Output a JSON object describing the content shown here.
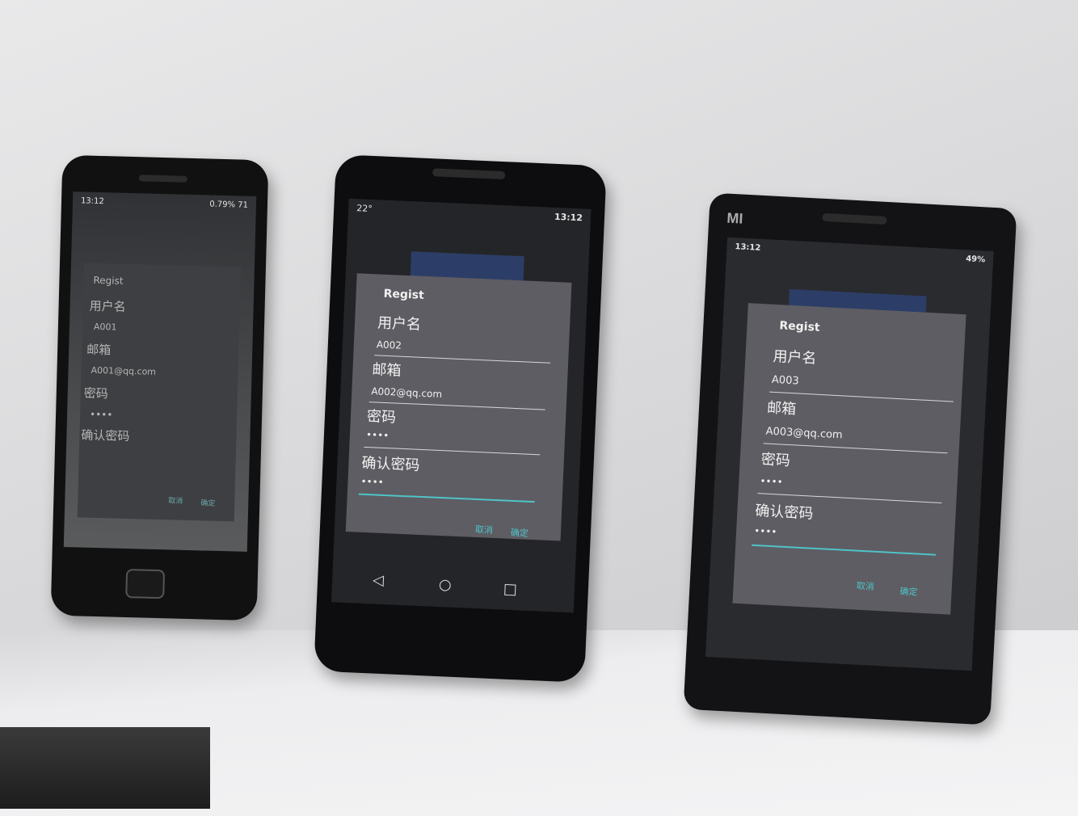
{
  "phones": [
    {
      "status_time": "13:12",
      "status_right": "0.79%   71",
      "dialog": {
        "title": "Regist",
        "username_label": "用户名",
        "username_value": "A001",
        "email_label": "邮箱",
        "email_value": "A001@qq.com",
        "password_label": "密码",
        "password_value": "••••",
        "confirm_label": "确认密码",
        "confirm_value": "",
        "cancel": "取消",
        "ok": "确定"
      }
    },
    {
      "status_time": "13:12",
      "status_left": "22°",
      "dialog": {
        "title": "Regist",
        "username_label": "用户名",
        "username_value": "A002",
        "email_label": "邮箱",
        "email_value": "A002@qq.com",
        "password_label": "密码",
        "password_value": "••••",
        "confirm_label": "确认密码",
        "confirm_value": "••••",
        "cancel": "取消",
        "ok": "确定"
      }
    },
    {
      "brand": "MI",
      "status_time": "13:12",
      "status_battery": "49%",
      "dialog": {
        "title": "Regist",
        "username_label": "用户名",
        "username_value": "A003",
        "email_label": "邮箱",
        "email_value": "A003@qq.com",
        "password_label": "密码",
        "password_value": "••••",
        "confirm_label": "确认密码",
        "confirm_value": "••••",
        "cancel": "取消",
        "ok": "确定"
      }
    }
  ],
  "colors": {
    "accent": "#4fc3c8",
    "dialog_bg": "#5e5d63"
  }
}
